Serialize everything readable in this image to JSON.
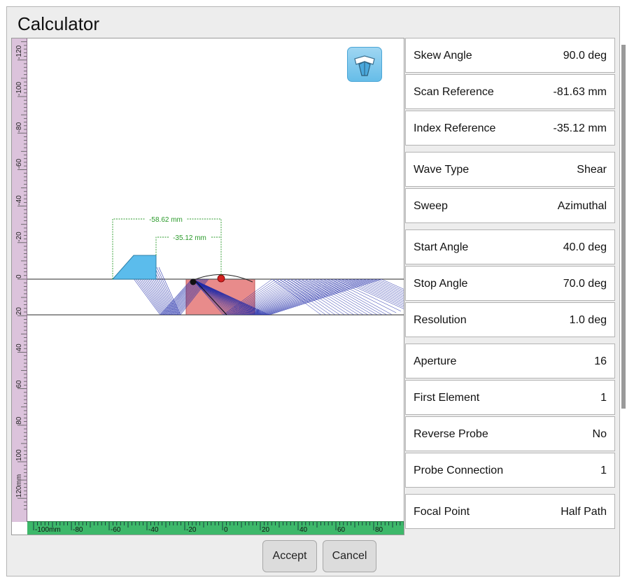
{
  "window": {
    "title": "Calculator"
  },
  "plot": {
    "dim_outer": "-58.62 mm",
    "dim_inner": "-35.12 mm",
    "vertical_ruler_ticks": [
      "-120",
      "-100",
      "-80",
      "-60",
      "-40",
      "-20",
      "0",
      "20",
      "40",
      "60",
      "80",
      "100",
      "120mm"
    ],
    "horizontal_ruler_ticks": [
      "-100mm",
      "-80",
      "-60",
      "-40",
      "-20",
      "0",
      "20",
      "40",
      "60",
      "80"
    ],
    "colors": {
      "part_fill": "#e88b8b",
      "wedge_fill": "#5bbcec",
      "beam": "#1f2aa8",
      "dimension": "#2a9a2a",
      "ruler_v": "#dcc3dc",
      "ruler_h": "#3db86a"
    }
  },
  "toolbar": {
    "probe_icon": "probe-wedge-icon"
  },
  "params": [
    {
      "label": "Skew Angle",
      "value": "90.0 deg"
    },
    {
      "label": "Scan Reference",
      "value": "-81.63 mm"
    },
    {
      "label": "Index Reference",
      "value": "-35.12 mm"
    },
    {
      "label": "Wave Type",
      "value": "Shear"
    },
    {
      "label": "Sweep",
      "value": "Azimuthal"
    },
    {
      "label": "Start Angle",
      "value": "40.0 deg"
    },
    {
      "label": "Stop Angle",
      "value": "70.0 deg"
    },
    {
      "label": "Resolution",
      "value": "1.0 deg"
    },
    {
      "label": "Aperture",
      "value": "16"
    },
    {
      "label": "First Element",
      "value": "1"
    },
    {
      "label": "Reverse Probe",
      "value": "No"
    },
    {
      "label": "Probe Connection",
      "value": "1"
    },
    {
      "label": "Focal Point",
      "value": "Half Path"
    }
  ],
  "buttons": {
    "accept": "Accept",
    "cancel": "Cancel"
  }
}
